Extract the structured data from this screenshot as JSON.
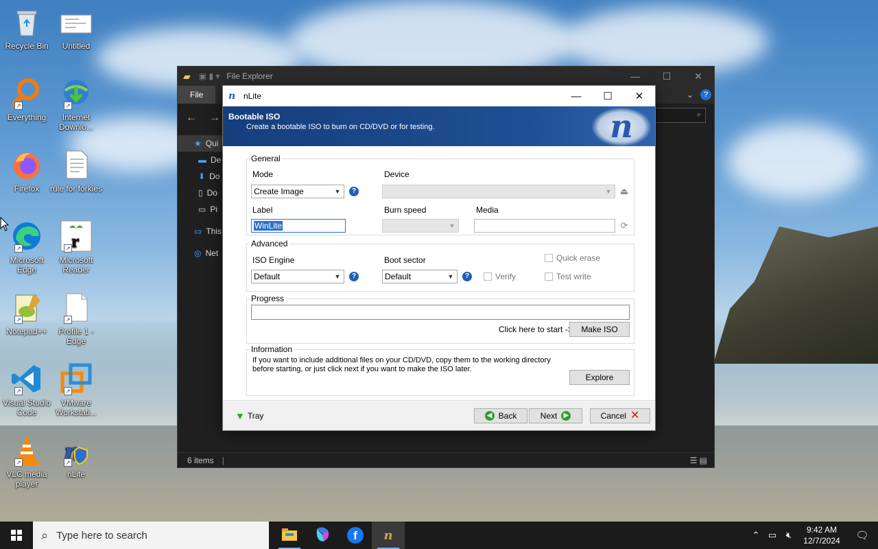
{
  "desktop": {
    "icons": [
      {
        "label": "Recycle Bin",
        "icon": "recycle-bin-icon"
      },
      {
        "label": "Untitled",
        "icon": "document-thumbnail-icon"
      },
      {
        "label": "Everything",
        "icon": "everything-search-icon"
      },
      {
        "label": "Internet Downlo...",
        "icon": "internet-download-manager-icon"
      },
      {
        "label": "Firefox",
        "icon": "firefox-icon"
      },
      {
        "label": "rule for forkies",
        "icon": "text-file-icon"
      },
      {
        "label": "Microsoft Edge",
        "icon": "edge-icon"
      },
      {
        "label": "Microsoft Reader",
        "icon": "microsoft-reader-icon"
      },
      {
        "label": "Notepad++",
        "icon": "notepad-plus-plus-icon"
      },
      {
        "label": "Profile 1 - Edge",
        "icon": "file-icon"
      },
      {
        "label": "Visual Studio Code",
        "icon": "vscode-icon"
      },
      {
        "label": "VMware Workstati...",
        "icon": "vmware-icon"
      },
      {
        "label": "VLC media player",
        "icon": "vlc-icon"
      },
      {
        "label": "nLite",
        "icon": "nlite-icon"
      }
    ]
  },
  "explorer": {
    "title": "File Explorer",
    "ribbon_file": "File",
    "sidebar": [
      "Qui",
      "De",
      "Do",
      "Do",
      "Pi",
      "This",
      "Net"
    ],
    "status": "6 items"
  },
  "nlite": {
    "title": "nLite",
    "banner_title": "Bootable ISO",
    "banner_subtitle": "Create a bootable ISO to burn on CD/DVD or for testing.",
    "general": {
      "title": "General",
      "mode_label": "Mode",
      "mode_value": "Create Image",
      "device_label": "Device",
      "device_value": "",
      "label_label": "Label",
      "label_value": "WinLite",
      "burn_speed_label": "Burn speed",
      "media_label": "Media",
      "media_value": ""
    },
    "advanced": {
      "title": "Advanced",
      "iso_engine_label": "ISO Engine",
      "iso_engine_value": "Default",
      "boot_sector_label": "Boot sector",
      "boot_sector_value": "Default",
      "verify_label": "Verify",
      "quick_erase_label": "Quick erase",
      "test_write_label": "Test write"
    },
    "progress": {
      "title": "Progress",
      "value": 0,
      "hint": "Click here to start ->",
      "make_iso_label": "Make ISO"
    },
    "information": {
      "title": "Information",
      "text_line1": "If you want to include additional files on your CD/DVD, copy them to the working directory",
      "text_line2": "before starting, or just click next if you want to make the ISO later.",
      "explore_label": "Explore"
    },
    "footer": {
      "tray_label": "Tray",
      "back_label": "Back",
      "next_label": "Next",
      "cancel_label": "Cancel"
    }
  },
  "taskbar": {
    "search_placeholder": "Type here to search",
    "apps": [
      "file-explorer-icon",
      "copilot-icon",
      "facebook-icon",
      "nlite-icon"
    ],
    "time": "9:42 AM",
    "date": "12/7/2024"
  },
  "colors": {
    "banner": "#1f4f93",
    "accent": "#2f6fc9",
    "cancel_x": "#d21414",
    "nav_green": "#2ca02c"
  }
}
